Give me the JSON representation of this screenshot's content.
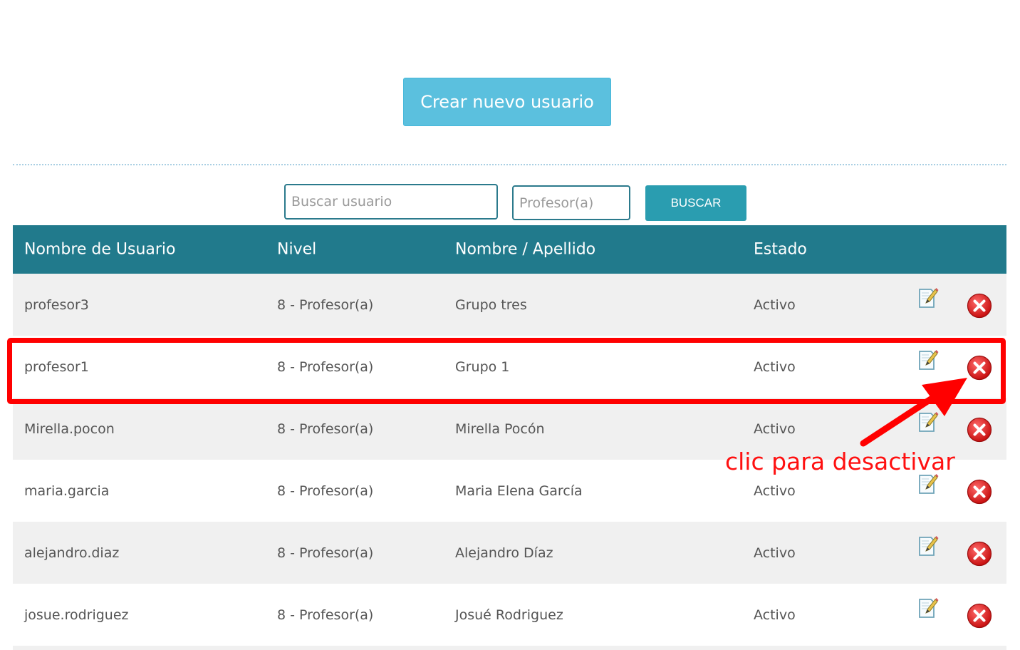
{
  "actions": {
    "create_label": "Crear nuevo usuario",
    "search_user_placeholder": "Buscar usuario",
    "level_placeholder": "Profesor(a)",
    "search_button": "BUSCAR"
  },
  "table": {
    "headers": [
      "Nombre de Usuario",
      "Nivel",
      "Nombre / Apellido",
      "Estado"
    ],
    "rows": [
      {
        "username": "profesor3",
        "level": "8 - Profesor(a)",
        "name": "Grupo tres",
        "status": "Activo"
      },
      {
        "username": "profesor1",
        "level": "8 - Profesor(a)",
        "name": "Grupo 1",
        "status": "Activo"
      },
      {
        "username": "Mirella.pocon",
        "level": "8 - Profesor(a)",
        "name": "Mirella Pocón",
        "status": "Activo"
      },
      {
        "username": "maria.garcia",
        "level": "8 - Profesor(a)",
        "name": "Maria Elena García",
        "status": "Activo"
      },
      {
        "username": "alejandro.diaz",
        "level": "8 - Profesor(a)",
        "name": "Alejandro Díaz",
        "status": "Activo"
      },
      {
        "username": "josue.rodriguez",
        "level": "8 - Profesor(a)",
        "name": "Josué Rodriguez",
        "status": "Activo"
      }
    ],
    "row_icons": [
      "edit-icon",
      "delete-icon"
    ]
  },
  "annotation": {
    "text": "clic para desactivar",
    "color": "#ff0000"
  },
  "colors": {
    "primary_button": "#5bc0de",
    "header_bg": "#217a8c",
    "search_button": "#2a9db0"
  }
}
